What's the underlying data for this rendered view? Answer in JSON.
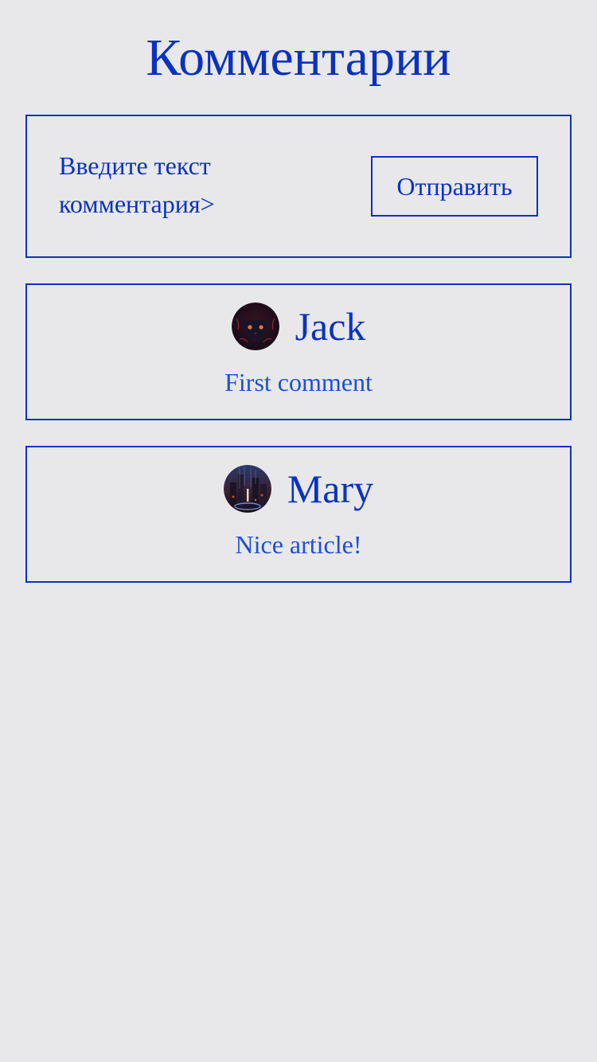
{
  "page": {
    "title": "Комментарии"
  },
  "form": {
    "input_placeholder": "Введите текст комментария>",
    "input_value": "",
    "submit_label": "Отправить"
  },
  "comments": [
    {
      "author": "Jack",
      "text": "First comment",
      "avatar_icon": "cat-avatar-icon"
    },
    {
      "author": "Mary",
      "text": "Nice article!",
      "avatar_icon": "city-night-avatar-icon"
    }
  ],
  "colors": {
    "background": "#e8e8ea",
    "accent": "#0a32c2",
    "comment_text": "#1d4fd6"
  }
}
